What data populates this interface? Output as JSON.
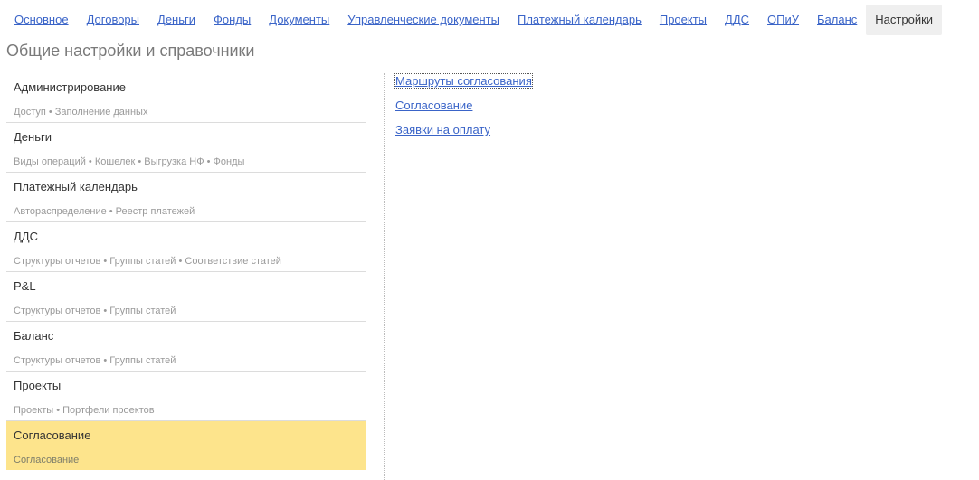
{
  "nav": {
    "tabs": [
      {
        "label": "Основное"
      },
      {
        "label": "Договоры"
      },
      {
        "label": "Деньги"
      },
      {
        "label": "Фонды"
      },
      {
        "label": "Документы"
      },
      {
        "label": "Управленческие документы"
      },
      {
        "label": "Платежный календарь"
      },
      {
        "label": "Проекты"
      },
      {
        "label": "ДДС"
      },
      {
        "label": "ОПиУ"
      },
      {
        "label": "Баланс"
      },
      {
        "label": "Настройки"
      }
    ],
    "active_tab": "Настройки"
  },
  "page": {
    "title": "Общие настройки и справочники"
  },
  "groups": [
    {
      "title": "Администрирование",
      "subtitle": "Доступ • Заполнение данных"
    },
    {
      "title": "Деньги",
      "subtitle": "Виды операций • Кошелек • Выгрузка НФ • Фонды"
    },
    {
      "title": "Платежный календарь",
      "subtitle": "Автораспределение • Реестр платежей"
    },
    {
      "title": "ДДС",
      "subtitle": "Структуры отчетов • Группы статей • Соответствие статей"
    },
    {
      "title": "P&L",
      "subtitle": "Структуры отчетов • Группы статей"
    },
    {
      "title": "Баланс",
      "subtitle": "Структуры отчетов • Группы статей"
    },
    {
      "title": "Проекты",
      "subtitle": "Проекты • Портфели проектов"
    },
    {
      "title": "Согласование",
      "subtitle": "Согласование"
    }
  ],
  "selected_group": "Согласование",
  "links": [
    {
      "label": "Маршруты согласования"
    },
    {
      "label": "Согласование"
    },
    {
      "label": "Заявки на оплату"
    }
  ],
  "colors": {
    "link": "#3a64c8",
    "selected_bg": "#fde48c",
    "active_tab_bg": "#efefef"
  }
}
